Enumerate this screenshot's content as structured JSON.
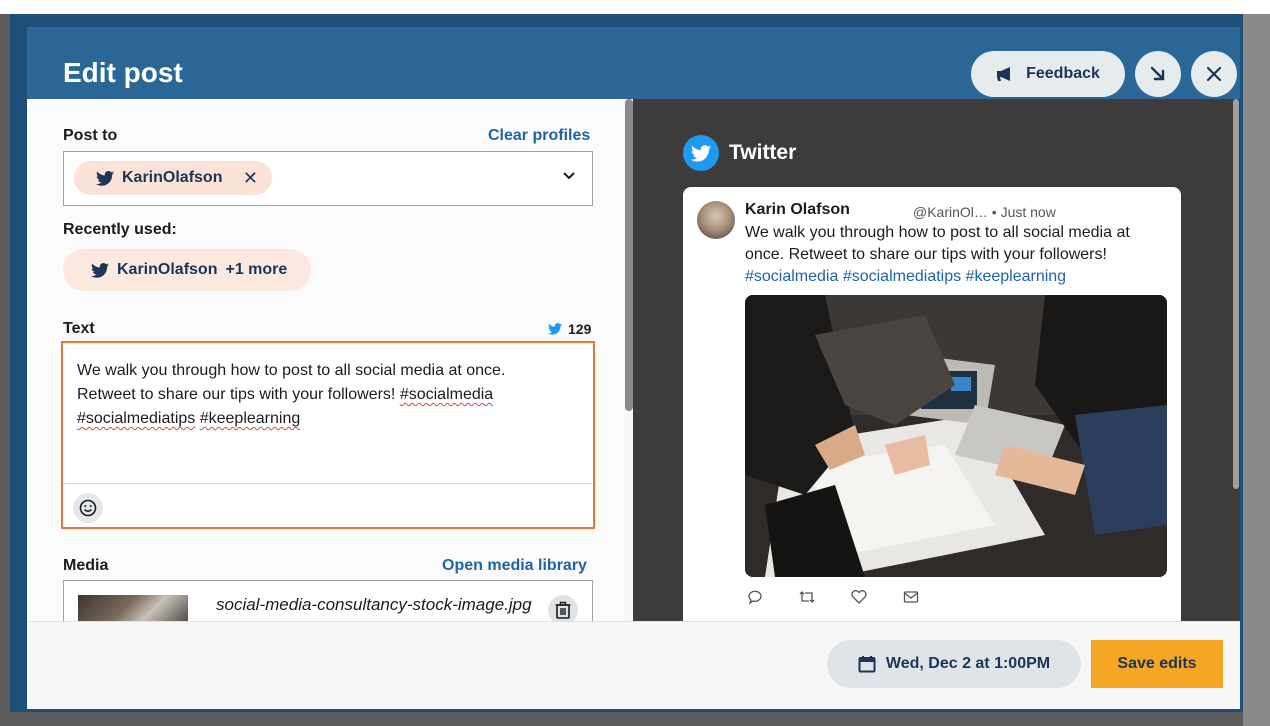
{
  "modal": {
    "title": "Edit post",
    "feedback_label": "Feedback",
    "minimize_icon": "arrow-down-right-icon",
    "close_icon": "close-icon"
  },
  "composer": {
    "post_to_label": "Post to",
    "clear_profiles_label": "Clear profiles",
    "selected_profile": "KarinOlafson",
    "recently_used_label": "Recently used:",
    "recent_chip": {
      "name": "KarinOlafson",
      "more": "+1 more"
    },
    "text_label": "Text",
    "char_count": "129",
    "text": {
      "line1": "We walk you through how to post to all social media at once.",
      "line2_prefix": "Retweet to share our tips with your followers! ",
      "tag1": "#socialmedia",
      "tag2": "#socialmediatips",
      "space": " ",
      "tag3": "#keeplearning"
    },
    "media_label": "Media",
    "open_media_library_label": "Open media library",
    "media_file": "social-media-consultancy-stock-image.jpg"
  },
  "preview": {
    "network": "Twitter",
    "author": "Karin Olafson",
    "handle_time": "@KarinOl… • Just now",
    "body": "We walk you through how to post to all social media at once. Retweet to share our tips with your followers!",
    "hashtags": "#socialmedia #socialmediatips #keeplearning"
  },
  "footer": {
    "schedule_label": "Wed, Dec 2 at 1:00PM",
    "save_label": "Save edits"
  },
  "colors": {
    "header": "#2b6796",
    "accent_orange": "#e8763a",
    "save_button": "#f5a623",
    "twitter_blue": "#1d9bf0",
    "link": "#1d64a6"
  }
}
